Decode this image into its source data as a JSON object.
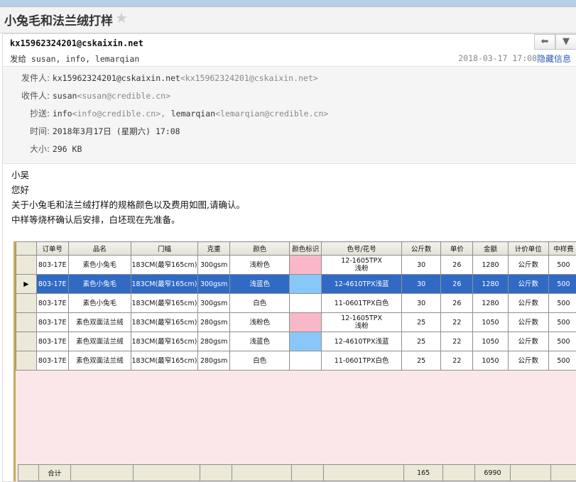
{
  "header": {
    "subject": "小兔毛和法兰绒打样",
    "star": "★"
  },
  "message": {
    "from_address": "kx15962324201@cskaixin.net",
    "to_line": "发给 susan, info, lemarqian",
    "date": "2018-03-17 17:08",
    "hide_info": "隐藏信息",
    "reply_icon": "⬅",
    "more_icon": "▼"
  },
  "details": {
    "sender_label": "发件人:",
    "sender_name": "kx15962324201@cskaixin.net",
    "sender_addr": "<kx15962324201@cskaixin.net>",
    "recipient_label": "收件人:",
    "recipient_name": "susan",
    "recipient_addr": "<susan@credible.cn>",
    "cc_label": "抄送:",
    "cc1_name": "info",
    "cc1_addr": "<info@credible.cn>,",
    "cc2_name": "lemarqian",
    "cc2_addr": "<lemarqian@credible.cn>",
    "time_label": "时间:",
    "time_value": "2018年3月17日 (星期六) 17:08",
    "size_label": "大小:",
    "size_value": "296 KB"
  },
  "body": [
    "小吴",
    "您好",
    "关于小兔毛和法兰绒打样的规格颜色以及费用如图,请确认。",
    "中样等烧杯确认后安排，白坯现在先准备。"
  ],
  "grid": {
    "columns": [
      "订单号",
      "品名",
      "门幅",
      "克重",
      "颜色",
      "颜色标识",
      "色号/花号",
      "公斤数",
      "单价",
      "金额",
      "计价单位",
      "中样费"
    ],
    "swatch_colors": {
      "pink": "#f9b8c9",
      "blue": "#88c8f8",
      "none": "#ffffff"
    },
    "rows": [
      {
        "order": "803-17E",
        "name": "素色小兔毛",
        "width": "183CM(最窄165cm)",
        "weight": "300gsm",
        "color": "浅粉色",
        "swatch": "pink",
        "code": "12-1605TPX\n浅粉",
        "kg": "30",
        "price": "26",
        "amount": "1280",
        "unit": "公斤数",
        "fee": "500",
        "selected": false
      },
      {
        "order": "803-17E",
        "name": "素色小兔毛",
        "width": "183CM(最窄165cm)",
        "weight": "300gsm",
        "color": "浅蓝色",
        "swatch": "blue",
        "code": "12-4610TPX浅蓝",
        "kg": "30",
        "price": "26",
        "amount": "1280",
        "unit": "公斤数",
        "fee": "500",
        "selected": true
      },
      {
        "order": "803-17E",
        "name": "素色小兔毛",
        "width": "183CM(最窄165cm)",
        "weight": "300gsm",
        "color": "白色",
        "swatch": "none",
        "code": "11-0601TPX白色",
        "kg": "30",
        "price": "26",
        "amount": "1280",
        "unit": "公斤数",
        "fee": "500",
        "selected": false
      },
      {
        "order": "803-17E",
        "name": "素色双面法兰绒",
        "width": "183CM(最窄165cm)",
        "weight": "280gsm",
        "color": "浅粉色",
        "swatch": "pink",
        "code": "12-1605TPX\n浅粉",
        "kg": "25",
        "price": "22",
        "amount": "1050",
        "unit": "公斤数",
        "fee": "500",
        "selected": false
      },
      {
        "order": "803-17E",
        "name": "素色双面法兰绒",
        "width": "183CM(最窄165cm)",
        "weight": "280gsm",
        "color": "浅蓝色",
        "swatch": "blue",
        "code": "12-4610TPX浅蓝",
        "kg": "25",
        "price": "22",
        "amount": "1050",
        "unit": "公斤数",
        "fee": "500",
        "selected": false
      },
      {
        "order": "803-17E",
        "name": "素色双面法兰绒",
        "width": "183CM(最窄165cm)",
        "weight": "280gsm",
        "color": "白色",
        "swatch": "none",
        "code": "11-0601TPX白色",
        "kg": "25",
        "price": "22",
        "amount": "1050",
        "unit": "公斤数",
        "fee": "500",
        "selected": false
      }
    ],
    "footer": {
      "label": "合计",
      "kg_total": "165",
      "amount_total": "6990"
    },
    "selected_marker": "▶"
  }
}
